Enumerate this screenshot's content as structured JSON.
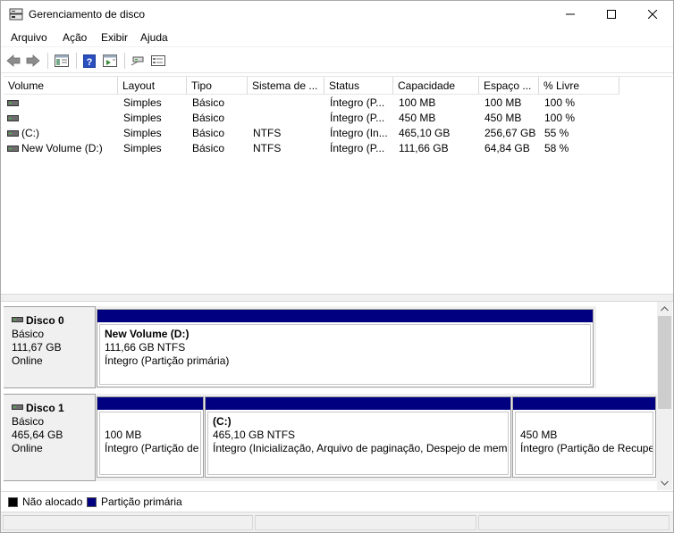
{
  "window": {
    "title": "Gerenciamento de disco",
    "icon": "disk-management-icon"
  },
  "menu": [
    "Arquivo",
    "Ação",
    "Exibir",
    "Ajuda"
  ],
  "toolbar": {
    "icons": [
      "back-arrow-icon",
      "forward-arrow-icon",
      "console-tree-icon",
      "help-icon",
      "action-pane-icon",
      "connect-drive-icon",
      "properties-icon"
    ]
  },
  "volume_list": {
    "columns": [
      "Volume",
      "Layout",
      "Tipo",
      "Sistema de ...",
      "Status",
      "Capacidade",
      "Espaço ...",
      "% Livre"
    ],
    "rows": [
      {
        "volume": "",
        "layout": "Simples",
        "tipo": "Básico",
        "sistema": "",
        "status": "Íntegro (P...",
        "capacidade": "100 MB",
        "espaco": "100 MB",
        "livre": "100 %"
      },
      {
        "volume": "",
        "layout": "Simples",
        "tipo": "Básico",
        "sistema": "",
        "status": "Íntegro (P...",
        "capacidade": "450 MB",
        "espaco": "450 MB",
        "livre": "100 %"
      },
      {
        "volume": "(C:)",
        "layout": "Simples",
        "tipo": "Básico",
        "sistema": "NTFS",
        "status": "Íntegro (In...",
        "capacidade": "465,10 GB",
        "espaco": "256,67 GB",
        "livre": "55 %"
      },
      {
        "volume": "New Volume (D:)",
        "layout": "Simples",
        "tipo": "Básico",
        "sistema": "NTFS",
        "status": "Íntegro (P...",
        "capacidade": "111,66 GB",
        "espaco": "64,84 GB",
        "livre": "58 %"
      }
    ]
  },
  "disks": [
    {
      "name": "Disco 0",
      "type": "Básico",
      "size": "111,67 GB",
      "state": "Online",
      "partitions": [
        {
          "title": "New Volume  (D:)",
          "size": "111,66 GB NTFS",
          "status": "Íntegro (Partição primária)"
        }
      ]
    },
    {
      "name": "Disco 1",
      "type": "Básico",
      "size": "465,64 GB",
      "state": "Online",
      "partitions": [
        {
          "title": "",
          "size": "100 MB",
          "status": "Íntegro (Partição de"
        },
        {
          "title": "(C:)",
          "size": "465,10 GB NTFS",
          "status": "Íntegro (Inicialização, Arquivo de paginação, Despejo de mem"
        },
        {
          "title": "",
          "size": "450 MB",
          "status": "Íntegro (Partição de Recupe"
        }
      ]
    }
  ],
  "legend": [
    {
      "label": "Não alocado",
      "color": "#000000"
    },
    {
      "label": "Partição primária",
      "color": "#000080"
    }
  ],
  "colors": {
    "primary_partition": "#000080",
    "unallocated": "#000000"
  }
}
